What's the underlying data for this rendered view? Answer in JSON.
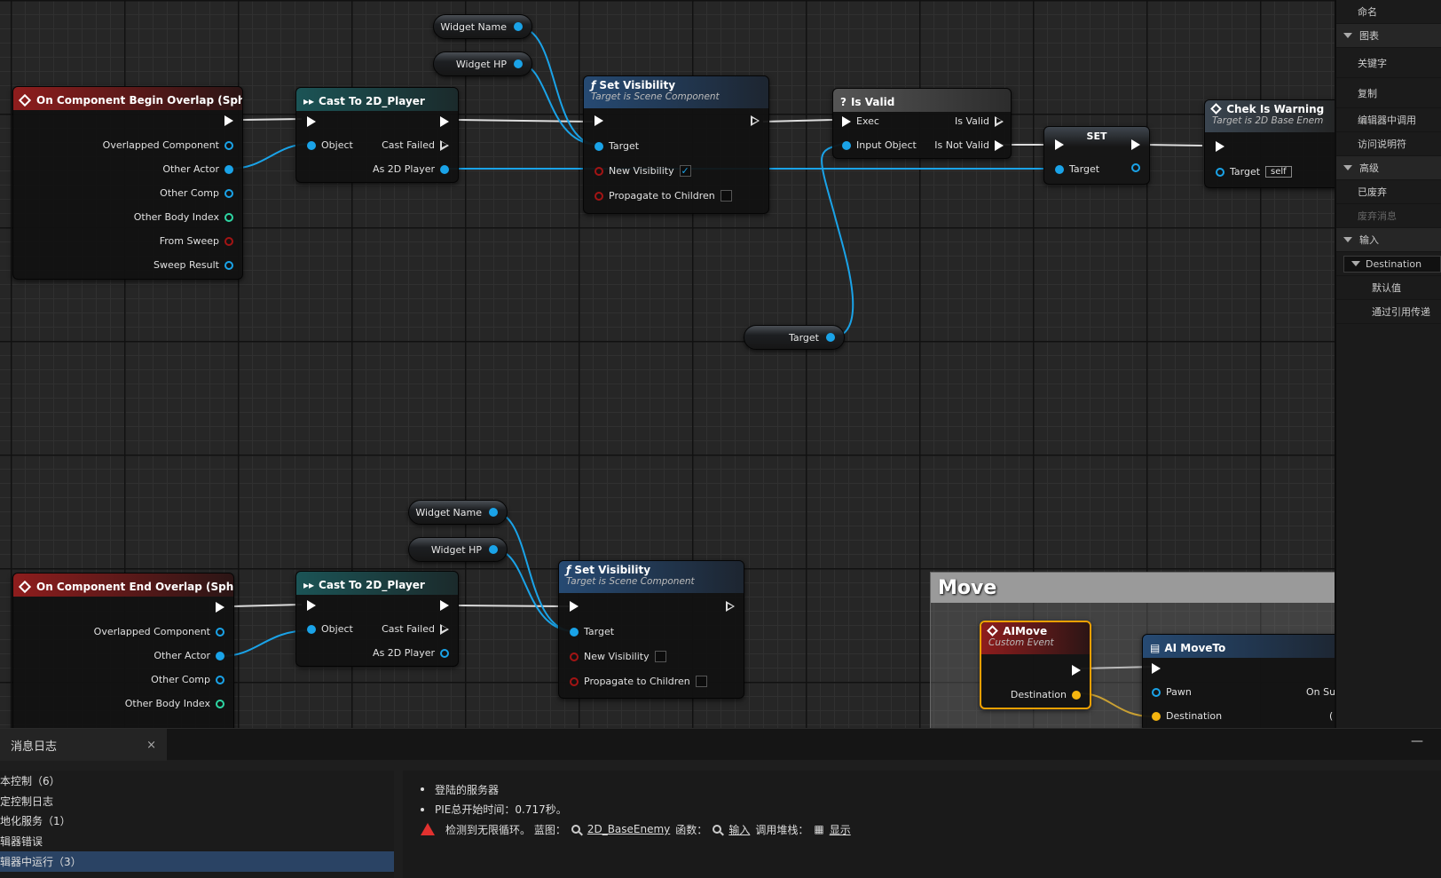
{
  "nodes": {
    "begin_overlap": {
      "title": "On Component Begin Overlap (Sphere)",
      "pins": [
        "Overlapped Component",
        "Other Actor",
        "Other Comp",
        "Other Body Index",
        "From Sweep",
        "Sweep Result"
      ]
    },
    "end_overlap": {
      "title": "On Component End Overlap (Sphere)",
      "pins": [
        "Overlapped Component",
        "Other Actor",
        "Other Comp",
        "Other Body Index"
      ]
    },
    "cast1": {
      "title": "Cast To 2D_Player",
      "object": "Object",
      "failed": "Cast Failed",
      "as": "As 2D Player"
    },
    "cast2": {
      "title": "Cast To 2D_Player",
      "object": "Object",
      "failed": "Cast Failed",
      "as": "As 2D Player"
    },
    "setvis1": {
      "title": "Set Visibility",
      "subtitle": "Target is Scene Component",
      "target": "Target",
      "newvis": "New Visibility",
      "propagate": "Propagate to Children",
      "checked": "✓"
    },
    "setvis2": {
      "title": "Set Visibility",
      "subtitle": "Target is Scene Component",
      "target": "Target",
      "newvis": "New Visibility",
      "propagate": "Propagate to Children"
    },
    "isvalid": {
      "title": "Is Valid",
      "exec": "Exec",
      "input": "Input Object",
      "valid": "Is Valid",
      "notvalid": "Is Not Valid"
    },
    "set": {
      "title": "SET",
      "target": "Target"
    },
    "warning": {
      "title": "Chek Is Warning",
      "subtitle": "Target is 2D Base Enem",
      "target": "Target",
      "self": "self"
    },
    "getters": {
      "widget_name": "Widget Name",
      "widget_hp": "Widget HP",
      "target": "Target"
    },
    "aimove": {
      "title": "AIMove",
      "subtitle": "Custom Event",
      "dest": "Destination"
    },
    "aimoveto": {
      "title": "AI MoveTo",
      "pawn": "Pawn",
      "dest": "Destination",
      "onsu": "On Su",
      "paren": "("
    },
    "comment": "Move"
  },
  "details": {
    "rows": [
      "命名",
      "图表",
      "关键字",
      "复制",
      "编辑器中调用",
      "访问说明符",
      "高级",
      "已废弃",
      "废弃消息",
      "输入",
      "Destination",
      "默认值",
      "通过引用传递"
    ]
  },
  "log": {
    "tab": "消息日志",
    "close": "×",
    "minimize": "—",
    "categories": [
      "本控制（6）",
      "定控制日志",
      "地化服务（1）",
      "辑器错误",
      "辑器中运行（3）"
    ],
    "messages": {
      "m1": "登陆的服务器",
      "m2": "PIE总开始时间：0.717秒。",
      "warn_text": "检测到无限循环。 蓝图：",
      "bp_link": "2D_BaseEnemy",
      "func_label": "函数：",
      "func_link": "输入",
      "stack_label": "调用堆栈：",
      "show_link": "显示"
    }
  },
  "colors": {
    "exec": "#ffffff",
    "object": "#1aa3e8",
    "int": "#2ed7a4",
    "bool": "#a31414",
    "vector": "#f5b50f"
  }
}
